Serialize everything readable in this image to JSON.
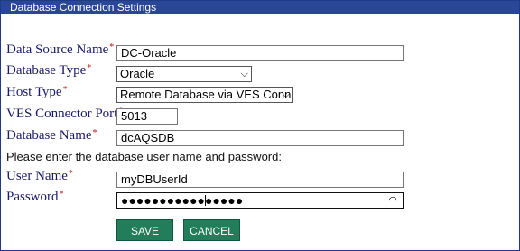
{
  "panel": {
    "title": "Database Connection Settings"
  },
  "form": {
    "data_source_name": {
      "label": "Data Source Name",
      "value": "DC-Oracle"
    },
    "database_type": {
      "label": "Database Type",
      "value": "Oracle"
    },
    "host_type": {
      "label": "Host Type",
      "value": "Remote Database via VES Connector"
    },
    "ves_connector_port": {
      "label": "VES Connector Port",
      "value": "5013"
    },
    "database_name": {
      "label": "Database Name",
      "value": "dcAQSDB"
    },
    "note": "Please enter the database user name and password:",
    "user_name": {
      "label": "User Name",
      "value": "myDBUserId"
    },
    "password": {
      "label": "Password",
      "masked": "●●●●●●●●●●●●●●●●"
    },
    "required_marker": "*"
  },
  "buttons": {
    "save": "SAVE",
    "cancel": "CANCEL"
  },
  "icons": {
    "select_arrow": "chevron-down-icon",
    "reveal": "eye-icon"
  },
  "colors": {
    "title_bg": "#2a4696",
    "label_text": "#1a1a6a",
    "required": "#c41212",
    "button_bg": "#217d5a"
  }
}
